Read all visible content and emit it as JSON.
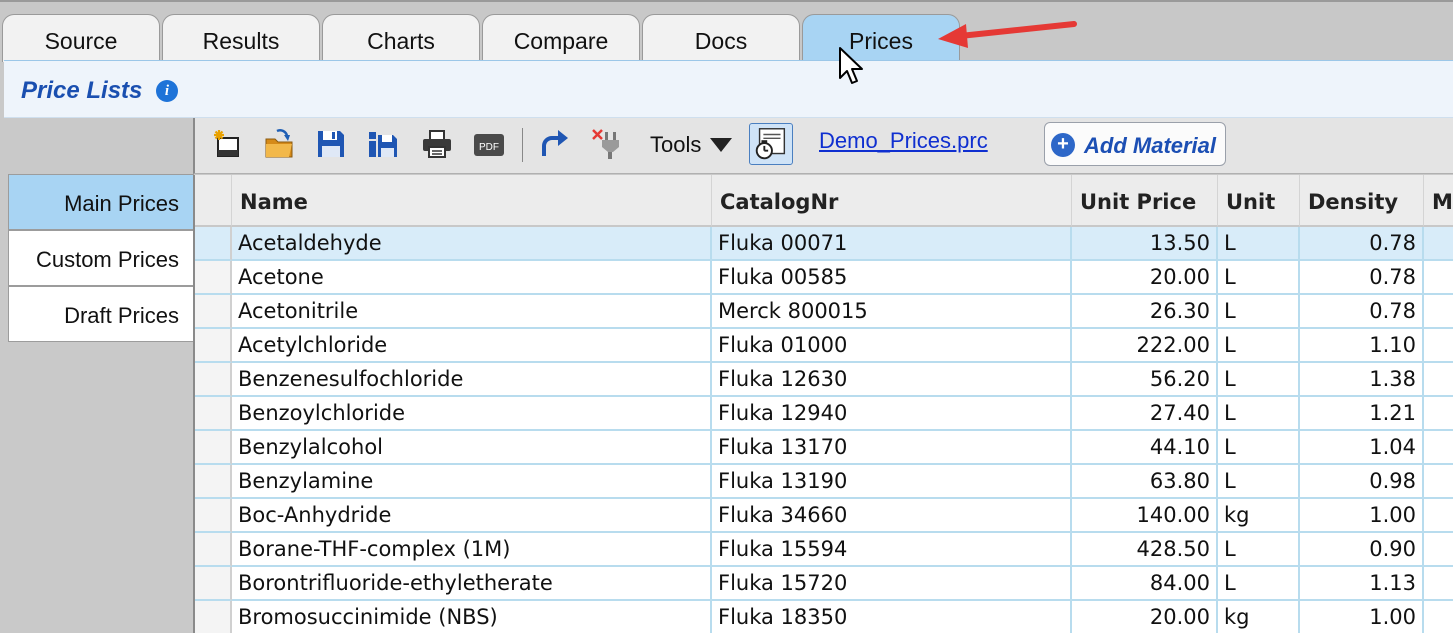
{
  "tabs": [
    {
      "label": "Source"
    },
    {
      "label": "Results"
    },
    {
      "label": "Charts"
    },
    {
      "label": "Compare"
    },
    {
      "label": "Docs"
    },
    {
      "label": "Prices"
    }
  ],
  "active_tab": "Prices",
  "header": {
    "title": "Price Lists",
    "info_icon": "info-icon"
  },
  "toolbar": {
    "icons": [
      "new-list-icon",
      "open-folder-icon",
      "save-icon",
      "save-as-icon",
      "print-icon",
      "pdf-icon",
      "redo-icon",
      "disconnect-icon"
    ],
    "pdf_label": "PDF",
    "tools_label": "Tools",
    "file_name": "Demo_Prices.prc",
    "add_material_label": "Add Material"
  },
  "sidebar": {
    "items": [
      {
        "label": "Main Prices"
      },
      {
        "label": "Custom Prices"
      },
      {
        "label": "Draft Prices"
      }
    ]
  },
  "table": {
    "columns": [
      "Name",
      "CatalogNr",
      "Unit Price",
      "Unit",
      "Density",
      "M"
    ],
    "rows": [
      {
        "name": "Acetaldehyde",
        "catalog": "Fluka 00071",
        "price": "13.50",
        "unit": "L",
        "density": "0.78"
      },
      {
        "name": "Acetone",
        "catalog": "Fluka 00585",
        "price": "20.00",
        "unit": "L",
        "density": "0.78"
      },
      {
        "name": "Acetonitrile",
        "catalog": "Merck 800015",
        "price": "26.30",
        "unit": "L",
        "density": "0.78"
      },
      {
        "name": "Acetylchloride",
        "catalog": "Fluka 01000",
        "price": "222.00",
        "unit": "L",
        "density": "1.10"
      },
      {
        "name": "Benzenesulfochloride",
        "catalog": "Fluka 12630",
        "price": "56.20",
        "unit": "L",
        "density": "1.38"
      },
      {
        "name": "Benzoylchloride",
        "catalog": "Fluka 12940",
        "price": "27.40",
        "unit": "L",
        "density": "1.21"
      },
      {
        "name": "Benzylalcohol",
        "catalog": "Fluka 13170",
        "price": "44.10",
        "unit": "L",
        "density": "1.04"
      },
      {
        "name": "Benzylamine",
        "catalog": "Fluka 13190",
        "price": "63.80",
        "unit": "L",
        "density": "0.98"
      },
      {
        "name": "Boc-Anhydride",
        "catalog": "Fluka 34660",
        "price": "140.00",
        "unit": "kg",
        "density": "1.00"
      },
      {
        "name": "Borane-THF-complex (1M)",
        "catalog": "Fluka 15594",
        "price": "428.50",
        "unit": "L",
        "density": "0.90"
      },
      {
        "name": "Borontrifluoride-ethyletherate",
        "catalog": "Fluka 15720",
        "price": "84.00",
        "unit": "L",
        "density": "1.13"
      },
      {
        "name": "Bromosuccinimide (NBS)",
        "catalog": "Fluka 18350",
        "price": "20.00",
        "unit": "kg",
        "density": "1.00"
      }
    ]
  },
  "colors": {
    "active_tab": "#a8d4f3",
    "accent": "#1a4fb0",
    "annotation_arrow": "#e53935",
    "grid_line": "#b8dcee"
  }
}
